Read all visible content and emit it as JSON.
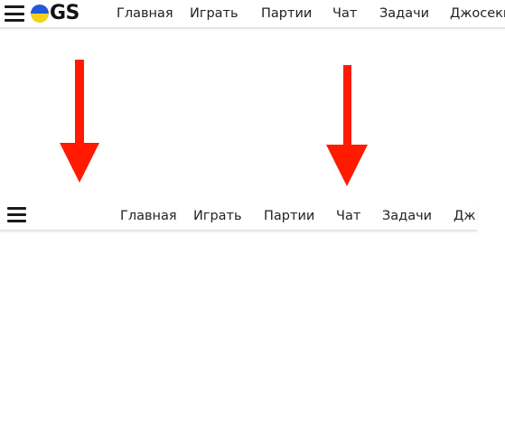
{
  "top_nav": {
    "logo_text": "GS",
    "items": [
      "Главная",
      "Играть",
      "Партии",
      "Чат",
      "Задачи",
      "Джосеки"
    ]
  },
  "bottom_nav": {
    "items": [
      "Главная",
      "Играть",
      "Партии",
      "Чат",
      "Задачи",
      "Дж"
    ]
  },
  "colors": {
    "arrow": "#ff1a00",
    "logo_blue": "#1f5bd8",
    "logo_yellow": "#f2d21a"
  },
  "icons": {
    "menu": "hamburger-menu-icon",
    "annotation": "red-arrow-down"
  }
}
